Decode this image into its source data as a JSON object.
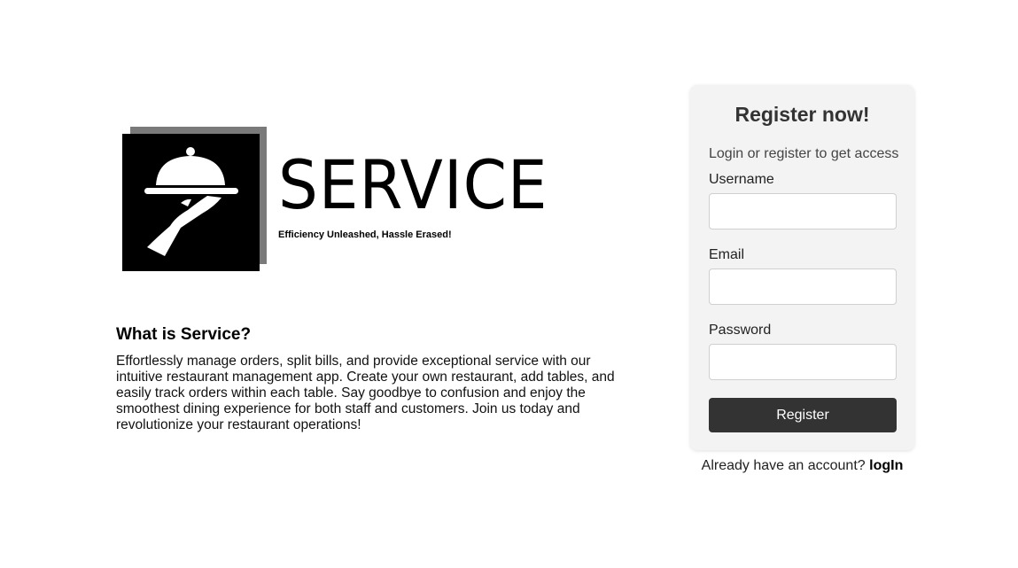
{
  "brand": {
    "name": "SERVICE",
    "tagline": "Efficiency Unleashed, Hassle Erased!",
    "logo_icon": "cloche-on-hand-icon"
  },
  "about": {
    "title": "What is Service?",
    "body": "Effortlessly manage orders, split bills, and provide exceptional service with our intuitive restaurant management app. Create your own restaurant, add tables, and easily track orders within each table. Say goodbye to confusion and enjoy the smoothest dining experience for both staff and customers. Join us today and revolutionize your restaurant operations!"
  },
  "register": {
    "title": "Register now!",
    "subtitle": "Login or register to get access",
    "fields": [
      {
        "label": "Username",
        "value": "",
        "placeholder": ""
      },
      {
        "label": "Email",
        "value": "",
        "placeholder": ""
      },
      {
        "label": "Password",
        "value": "",
        "placeholder": ""
      }
    ],
    "button_label": "Register"
  },
  "login_prompt": {
    "text": "Already have an account? ",
    "link_label": "logIn"
  },
  "colors": {
    "button_bg": "#333333",
    "card_bg": "#f3f3f3",
    "logo_bg": "#000000",
    "logo_shadow": "#7a7a7a"
  }
}
